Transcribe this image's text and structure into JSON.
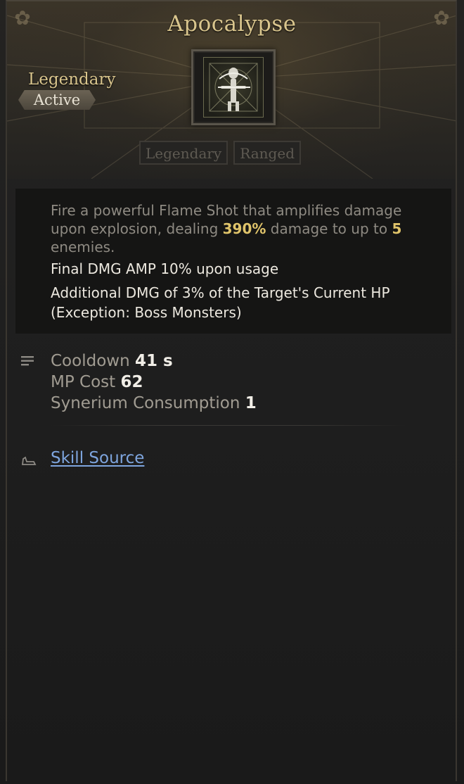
{
  "skill": {
    "name": "Apocalypse",
    "grade": "Legendary",
    "type": "Active",
    "icon": "skeleton-archer-icon",
    "tags": [
      "Legendary",
      "Ranged"
    ]
  },
  "description": {
    "part1": "Fire a powerful Flame Shot that amplifies damage upon explosion, dealing ",
    "damage_percent": "390%",
    "part2": " damage to up to ",
    "enemy_count": "5",
    "part3": " enemies.",
    "effect1": "Final DMG AMP 10% upon usage",
    "effect2": "Additional DMG of 3% of the Target's Current HP (Exception: Boss Monsters)"
  },
  "stats": {
    "icon": "list-icon",
    "cooldown_label": "Cooldown",
    "cooldown_value": "41 s",
    "mp_label": "MP Cost",
    "mp_value": "62",
    "synerium_label": "Synerium Consumption",
    "synerium_value": "1"
  },
  "source": {
    "icon": "source-icon",
    "label": "Skill Source"
  },
  "colors": {
    "title_gold": "#d9c58d",
    "highlight": "#e0c46a",
    "link_blue": "#7ea5de"
  }
}
